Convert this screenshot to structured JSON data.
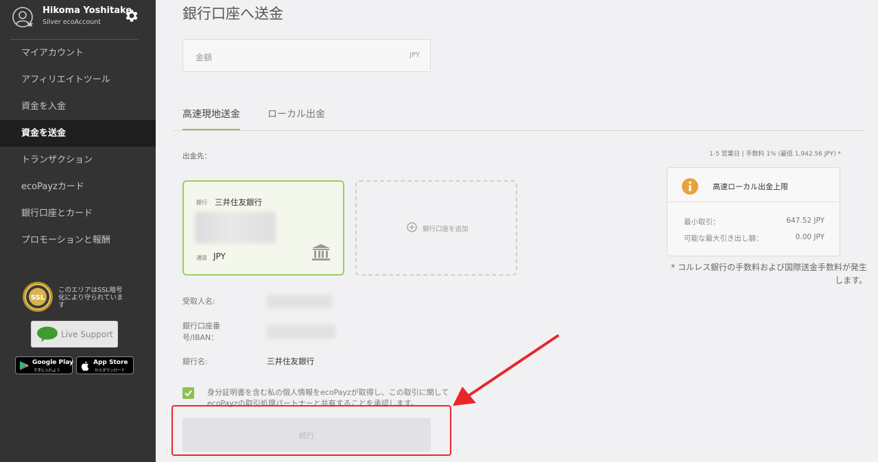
{
  "sidebar": {
    "user_name": "Hikoma Yoshitake",
    "user_level": "Silver ecoAccount",
    "nav": [
      {
        "label": "マイアカウント"
      },
      {
        "label": "アフィリエイトツール"
      },
      {
        "label": "資金を入金"
      },
      {
        "label": "資金を送金"
      },
      {
        "label": "トランザクション"
      },
      {
        "label": "ecoPayzカード"
      },
      {
        "label": "銀行口座とカード"
      },
      {
        "label": "プロモーションと報酬"
      }
    ],
    "active_item": "資金を送金",
    "ssl_badge": "SSL",
    "ssl_text": "このエリアはSSL暗号化により守られています",
    "live_support": "Live Support",
    "google_play_main": "Google Play",
    "google_play_sub": "で手に入れよう",
    "app_store_main": "App Store",
    "app_store_sub": "からダウンロード"
  },
  "main": {
    "title": "銀行口座へ送金",
    "amount_placeholder": "金額",
    "amount_currency": "JPY",
    "tabs": [
      {
        "label": "高速現地送金"
      },
      {
        "label": "ローカル出金"
      }
    ],
    "active_tab": "高速現地送金",
    "destination_label": "出金先：",
    "bank_card": {
      "bank_label": "銀行",
      "bank_name": "三井住友銀行",
      "currency_label": "通貨",
      "currency": "JPY"
    },
    "add_account": "銀行口座を追加",
    "recipient_label": "受取人名:",
    "account_label": "銀行口座番号/IBAN：",
    "bank_name_label": "銀行名:",
    "bank_name_value": "三井住友銀行",
    "consent": "身分証明書を含む私の個人情報をecoPayzが取得し、この取引に関してecoPayzの取引処理パートナーと共有することを承認します。",
    "submit": "続行"
  },
  "info": {
    "fee_note": "1-5 営業日 | 手数料 1% (最低 1,942.56 JPY) *",
    "limit_title": "高速ローカル出金上限",
    "min_label": "最小取引：",
    "min_value": "647.52 JPY",
    "max_label": "可能な最大引き出し額：",
    "max_value": "0.00 JPY",
    "footnote": "* コルレス銀行の手数料および国際送金手数料が発生します。"
  },
  "colors": {
    "sidebar_bg": "#333333",
    "accent_green": "#8cc152",
    "highlight_red": "#e8262a",
    "info_icon": "#e8a33d"
  },
  "icons": [
    "user-avatar-icon",
    "gear-icon",
    "ssl-badge-icon",
    "chat-bubble-icon",
    "google-play-icon",
    "apple-icon",
    "bank-icon",
    "plus-circle-icon",
    "info-icon",
    "check-icon",
    "arrow-annotation"
  ]
}
